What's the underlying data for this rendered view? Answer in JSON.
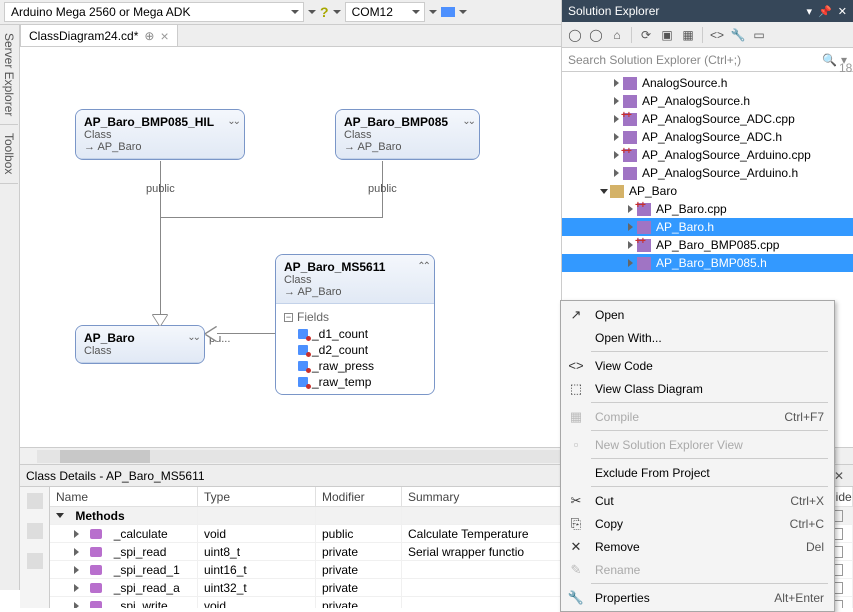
{
  "toolbar": {
    "board": "Arduino Mega 2560 or Mega ADK",
    "port": "COM12"
  },
  "side_tabs": [
    "Server Explorer",
    "Toolbox"
  ],
  "tab": {
    "name": "ClassDiagram24.cd*"
  },
  "diagram": {
    "boxes": {
      "bmp085_hil": {
        "name": "AP_Baro_BMP085_HIL",
        "type": "Class",
        "parent": "→ AP_Baro"
      },
      "bmp085": {
        "name": "AP_Baro_BMP085",
        "type": "Class",
        "parent": "→ AP_Baro"
      },
      "ap_baro": {
        "name": "AP_Baro",
        "type": "Class"
      },
      "ms5611": {
        "name": "AP_Baro_MS5611",
        "type": "Class",
        "parent": "→ AP_Baro",
        "fields_label": "Fields",
        "fields": [
          "_d1_count",
          "_d2_count",
          "_raw_press",
          "_raw_temp"
        ]
      }
    },
    "labels": {
      "public1": "public",
      "public2": "public",
      "public3": "pu..."
    }
  },
  "class_details": {
    "title": "Class Details - AP_Baro_MS5611",
    "columns": {
      "name": "Name",
      "type": "Type",
      "modifier": "Modifier",
      "summary": "Summary",
      "hide": "Hide"
    },
    "methods_label": "Methods",
    "rows": [
      {
        "name": "_calculate",
        "type": "void",
        "modifier": "public",
        "summary": "Calculate Temperature"
      },
      {
        "name": "_spi_read",
        "type": "uint8_t",
        "modifier": "private",
        "summary": "Serial wrapper functio"
      },
      {
        "name": "_spi_read_1",
        "type": "uint16_t",
        "modifier": "private",
        "summary": ""
      },
      {
        "name": "_spi_read_a",
        "type": "uint32_t",
        "modifier": "private",
        "summary": ""
      },
      {
        "name": "_spi_write",
        "type": "void",
        "modifier": "private",
        "summary": ""
      }
    ]
  },
  "solution_explorer": {
    "title": "Solution Explorer",
    "search_placeholder": "Search Solution Explorer (Ctrl+;)",
    "right_badge": "18",
    "items": [
      {
        "indent": 50,
        "icon": "h",
        "label": "AnalogSource.h",
        "tri": "r"
      },
      {
        "indent": 50,
        "icon": "h",
        "label": "AP_AnalogSource.h",
        "tri": "r"
      },
      {
        "indent": 50,
        "icon": "cpp",
        "label": "AP_AnalogSource_ADC.cpp",
        "tri": "r"
      },
      {
        "indent": 50,
        "icon": "h",
        "label": "AP_AnalogSource_ADC.h",
        "tri": "r"
      },
      {
        "indent": 50,
        "icon": "cpp",
        "label": "AP_AnalogSource_Arduino.cpp",
        "tri": "r"
      },
      {
        "indent": 50,
        "icon": "h",
        "label": "AP_AnalogSource_Arduino.h",
        "tri": "r"
      },
      {
        "indent": 36,
        "icon": "folder",
        "label": "AP_Baro",
        "tri": "d"
      },
      {
        "indent": 64,
        "icon": "cpp",
        "label": "AP_Baro.cpp",
        "tri": "r"
      },
      {
        "indent": 64,
        "icon": "h",
        "label": "AP_Baro.h",
        "tri": "r",
        "sel": true
      },
      {
        "indent": 64,
        "icon": "cpp",
        "label": "AP_Baro_BMP085.cpp",
        "tri": "r"
      },
      {
        "indent": 64,
        "icon": "h",
        "label": "AP_Baro_BMP085.h",
        "tri": "r",
        "sel": true
      }
    ]
  },
  "context_menu": {
    "items": [
      {
        "icon": "↗",
        "label": "Open"
      },
      {
        "icon": "",
        "label": "Open With..."
      },
      {
        "sep": true
      },
      {
        "icon": "<>",
        "label": "View Code"
      },
      {
        "icon": "⬚",
        "label": "View Class Diagram"
      },
      {
        "sep": true
      },
      {
        "icon": "▦",
        "label": "Compile",
        "short": "Ctrl+F7",
        "disabled": true
      },
      {
        "sep": true
      },
      {
        "icon": "▫",
        "label": "New Solution Explorer View",
        "disabled": true
      },
      {
        "sep": true
      },
      {
        "icon": "",
        "label": "Exclude From Project"
      },
      {
        "sep": true
      },
      {
        "icon": "✂",
        "label": "Cut",
        "short": "Ctrl+X"
      },
      {
        "icon": "⎘",
        "label": "Copy",
        "short": "Ctrl+C"
      },
      {
        "icon": "✕",
        "label": "Remove",
        "short": "Del"
      },
      {
        "icon": "✎",
        "label": "Rename",
        "disabled": true
      },
      {
        "sep": true
      },
      {
        "icon": "🔧",
        "label": "Properties",
        "short": "Alt+Enter"
      }
    ]
  }
}
